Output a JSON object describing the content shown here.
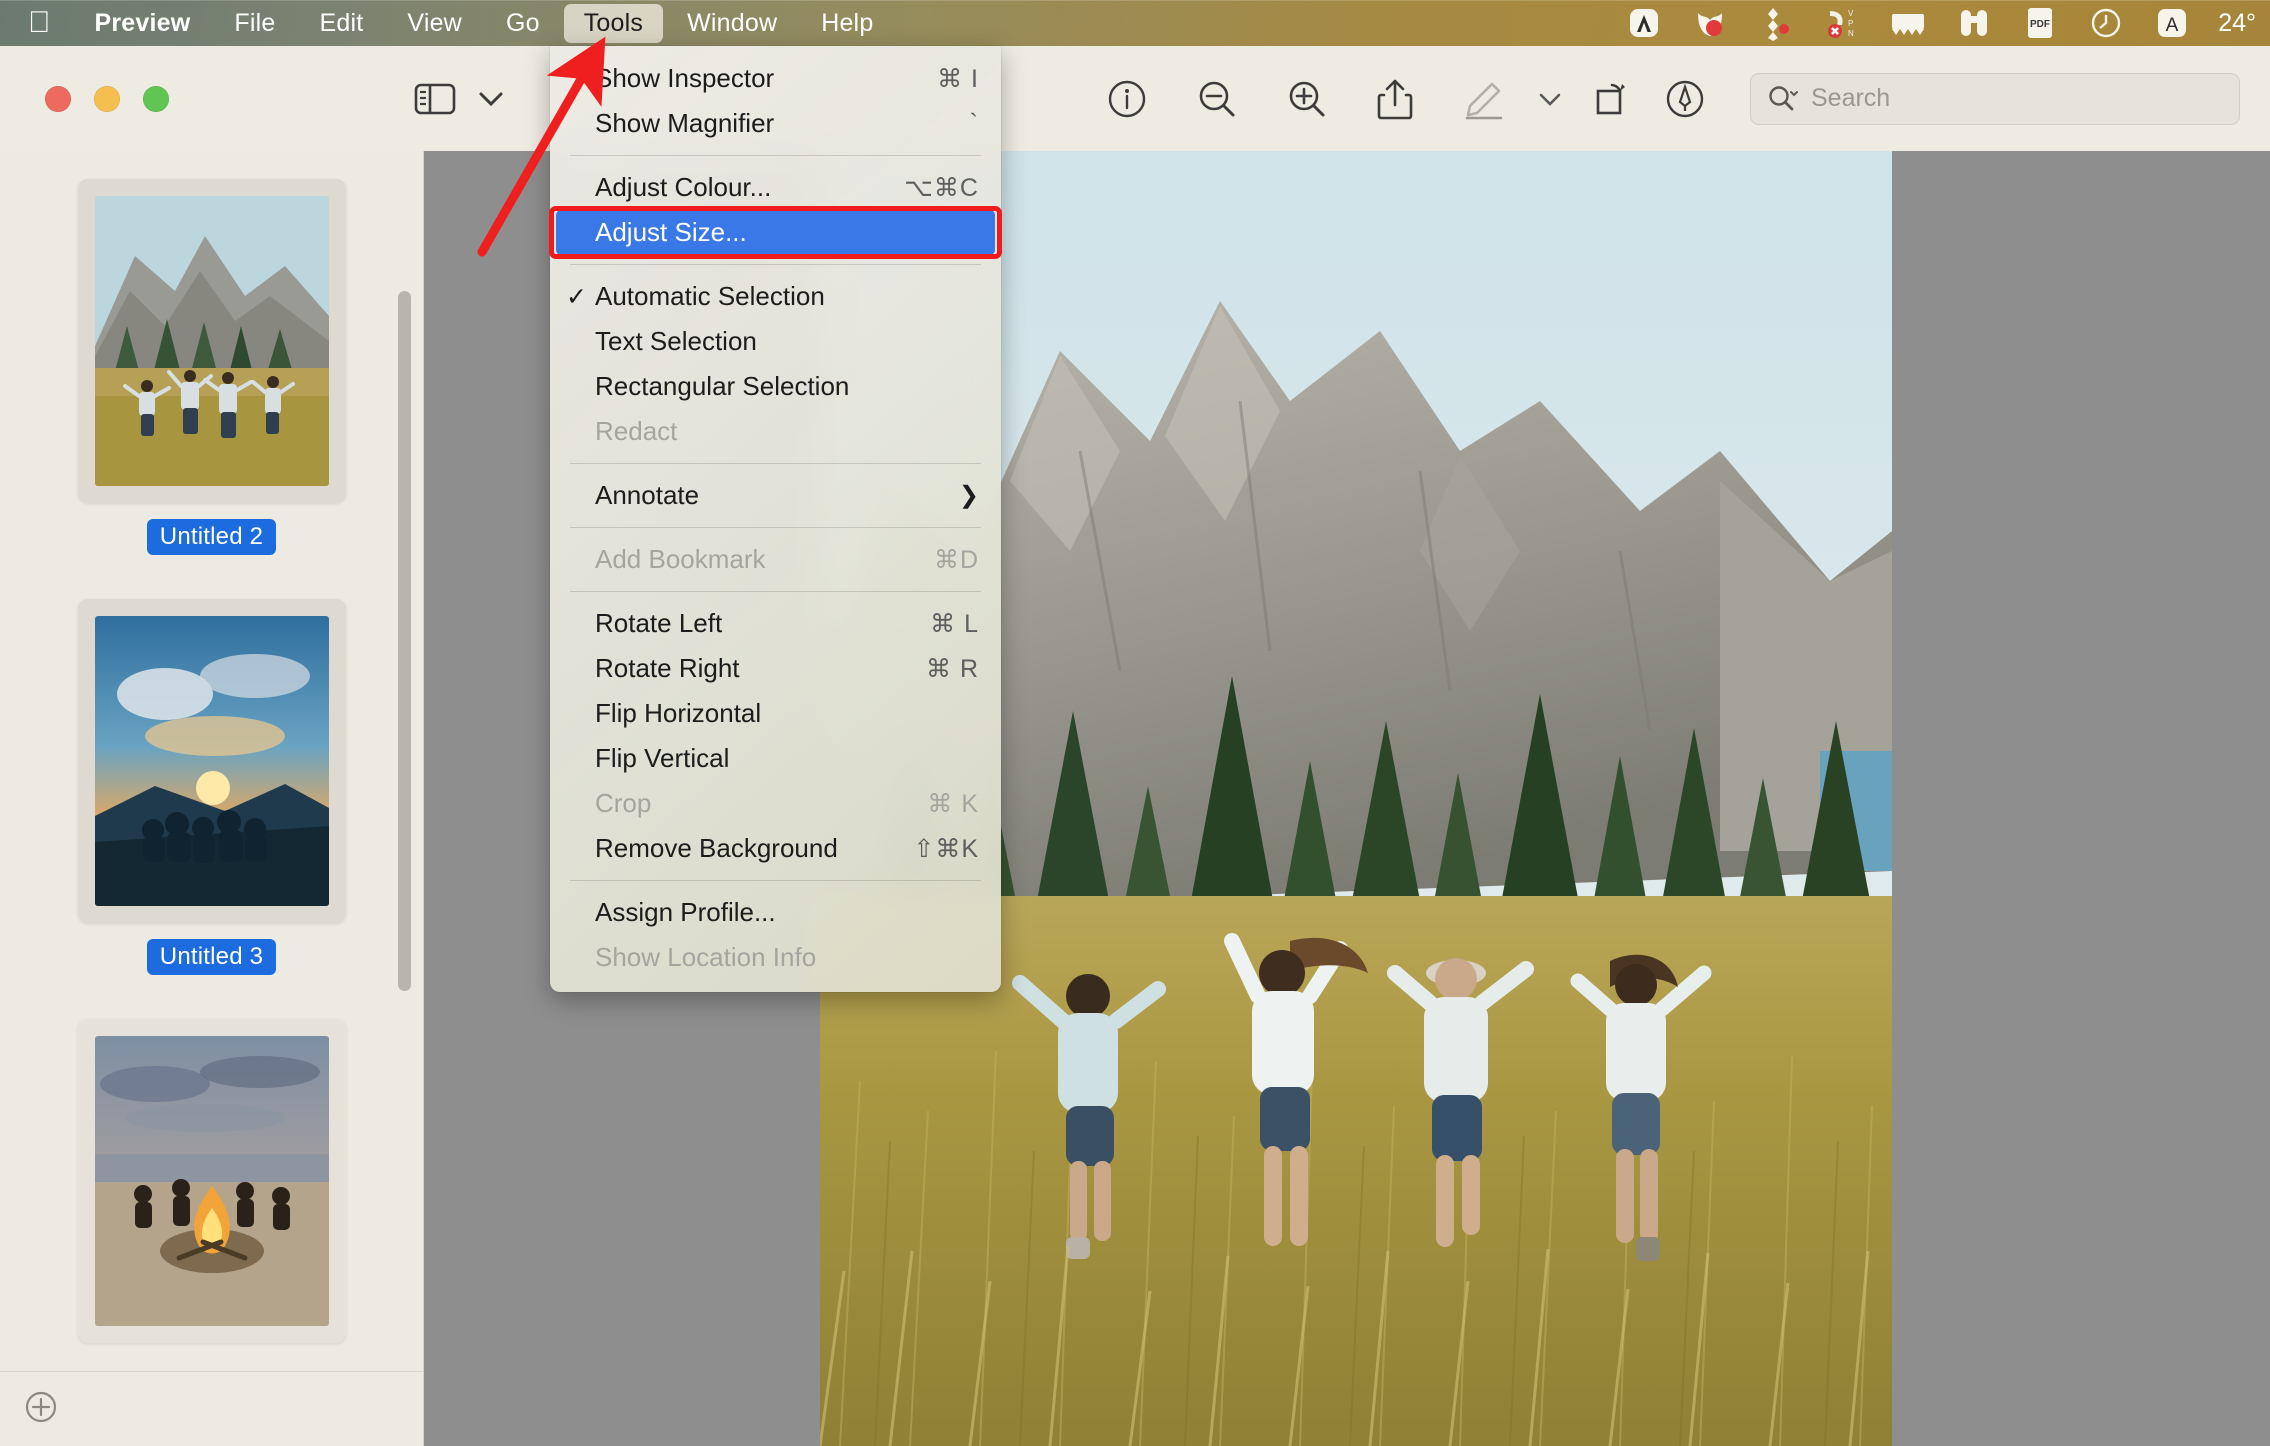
{
  "menubar": {
    "apple_icon": "apple-logo-icon",
    "items": [
      {
        "label": "Preview",
        "bold": true,
        "active": false
      },
      {
        "label": "File",
        "bold": false,
        "active": false
      },
      {
        "label": "Edit",
        "bold": false,
        "active": false
      },
      {
        "label": "View",
        "bold": false,
        "active": false
      },
      {
        "label": "Go",
        "bold": false,
        "active": false
      },
      {
        "label": "Tools",
        "bold": false,
        "active": true
      },
      {
        "label": "Window",
        "bold": false,
        "active": false
      },
      {
        "label": "Help",
        "bold": false,
        "active": false
      }
    ],
    "tray_icons": [
      "lambda-app-icon",
      "tulip-app-icon",
      "diamonds-app-icon",
      "vpn-off-icon",
      "waveform-icon",
      "binoculars-icon",
      "pdf-icon",
      "clock-history-icon",
      "input-source-a-icon"
    ],
    "clock": "24°"
  },
  "toolbar": {
    "traffic_lights": [
      "close-button",
      "minimize-button",
      "zoom-button"
    ],
    "sidebar_toggle": "sidebar-toggle-icon",
    "sidebar_chevron": "chevron-down-icon",
    "center_icons": [
      "info-icon",
      "zoom-out-icon",
      "zoom-in-icon",
      "share-icon"
    ],
    "markup_icon": "markup-pen-icon",
    "markup_chevron": "chevron-down-icon",
    "rotate_icon": "rotate-right-icon",
    "annotate_icon": "annotate-icon",
    "search": {
      "icon": "search-icon",
      "chevron": "chevron-down-icon",
      "placeholder": "Search",
      "value": ""
    }
  },
  "sidebar": {
    "thumbnails": [
      {
        "label": "Untitled 2",
        "selected": true,
        "image": "friends-running-meadow-mountain"
      },
      {
        "label": "Untitled 3",
        "selected": true,
        "image": "sunset-group-on-hill"
      },
      {
        "label": "",
        "selected": false,
        "image": "beach-campfire-evening"
      }
    ],
    "add_button": "add-page-icon"
  },
  "menu": {
    "title": "Tools",
    "groups": [
      {
        "items": [
          {
            "label": "Show Inspector",
            "shortcut": "⌘ I",
            "disabled": false,
            "checked": false,
            "selected": false,
            "submenu": false
          },
          {
            "label": "Show Magnifier",
            "shortcut": "`",
            "disabled": false,
            "checked": false,
            "selected": false,
            "submenu": false
          }
        ]
      },
      {
        "items": [
          {
            "label": "Adjust Colour...",
            "shortcut": "⌥⌘C",
            "disabled": false,
            "checked": false,
            "selected": false,
            "submenu": false
          },
          {
            "label": "Adjust Size...",
            "shortcut": "",
            "disabled": false,
            "checked": false,
            "selected": true,
            "submenu": false
          }
        ]
      },
      {
        "items": [
          {
            "label": "Automatic Selection",
            "shortcut": "",
            "disabled": false,
            "checked": true,
            "selected": false,
            "submenu": false
          },
          {
            "label": "Text Selection",
            "shortcut": "",
            "disabled": false,
            "checked": false,
            "selected": false,
            "submenu": false
          },
          {
            "label": "Rectangular Selection",
            "shortcut": "",
            "disabled": false,
            "checked": false,
            "selected": false,
            "submenu": false
          },
          {
            "label": "Redact",
            "shortcut": "",
            "disabled": true,
            "checked": false,
            "selected": false,
            "submenu": false
          }
        ]
      },
      {
        "items": [
          {
            "label": "Annotate",
            "shortcut": "",
            "disabled": false,
            "checked": false,
            "selected": false,
            "submenu": true
          }
        ]
      },
      {
        "items": [
          {
            "label": "Add Bookmark",
            "shortcut": "⌘D",
            "disabled": true,
            "checked": false,
            "selected": false,
            "submenu": false
          }
        ]
      },
      {
        "items": [
          {
            "label": "Rotate Left",
            "shortcut": "⌘ L",
            "disabled": false,
            "checked": false,
            "selected": false,
            "submenu": false
          },
          {
            "label": "Rotate Right",
            "shortcut": "⌘ R",
            "disabled": false,
            "checked": false,
            "selected": false,
            "submenu": false
          },
          {
            "label": "Flip Horizontal",
            "shortcut": "",
            "disabled": false,
            "checked": false,
            "selected": false,
            "submenu": false
          },
          {
            "label": "Flip Vertical",
            "shortcut": "",
            "disabled": false,
            "checked": false,
            "selected": false,
            "submenu": false
          },
          {
            "label": "Crop",
            "shortcut": "⌘ K",
            "disabled": true,
            "checked": false,
            "selected": false,
            "submenu": false
          },
          {
            "label": "Remove Background",
            "shortcut": "⇧⌘K",
            "disabled": false,
            "checked": false,
            "selected": false,
            "submenu": false
          }
        ]
      },
      {
        "items": [
          {
            "label": "Assign Profile...",
            "shortcut": "",
            "disabled": false,
            "checked": false,
            "selected": false,
            "submenu": false
          },
          {
            "label": "Show Location Info",
            "shortcut": "",
            "disabled": true,
            "checked": false,
            "selected": false,
            "submenu": false
          }
        ]
      }
    ]
  },
  "annotation": {
    "arrow_color": "#ef1f1f",
    "highlight_color": "#f01c1c",
    "highlight_target": "Adjust Size..."
  },
  "colors": {
    "selection_blue": "#3a78e7",
    "label_blue": "#1c6ce0",
    "canvas_grey": "#8e8e8e",
    "chrome": "#eeebe3"
  }
}
